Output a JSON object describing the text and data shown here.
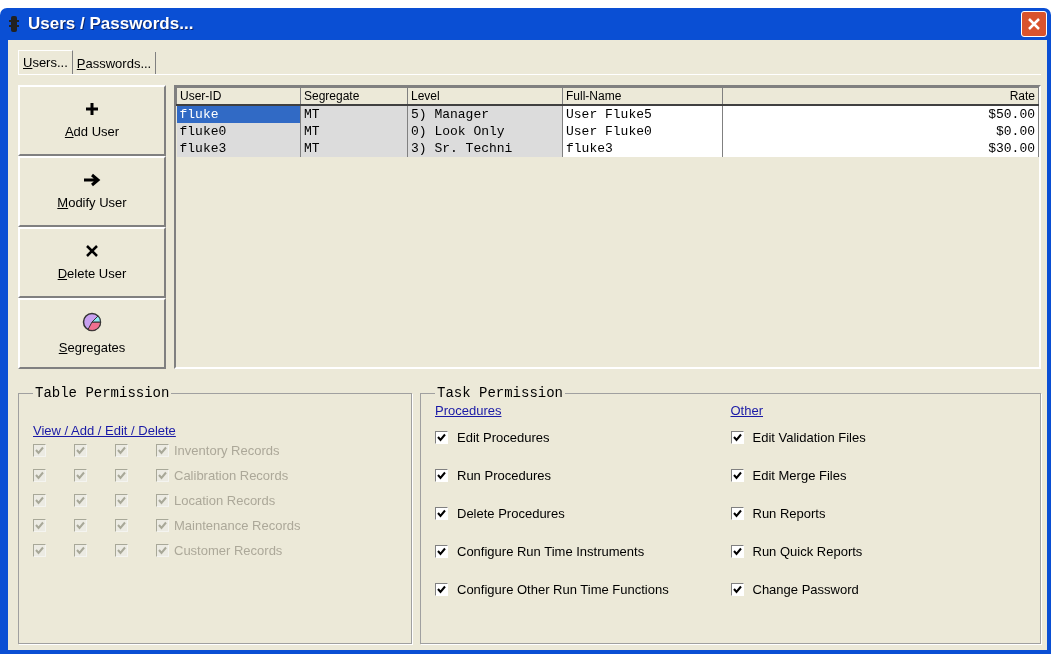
{
  "window": {
    "title": "Users / Passwords..."
  },
  "tabs": [
    {
      "label": "Users...",
      "selected": true
    },
    {
      "label": "Passwords...",
      "selected": false
    }
  ],
  "actions": [
    {
      "kind": "add",
      "label": "Add User"
    },
    {
      "kind": "modify",
      "label": "Modify User"
    },
    {
      "kind": "delete",
      "label": "Delete User"
    },
    {
      "kind": "segregates",
      "label": "Segregates"
    }
  ],
  "table": {
    "columns": [
      {
        "label": "User-ID",
        "kind": "text",
        "shaded": true
      },
      {
        "label": "Segregate",
        "kind": "text",
        "shaded": true
      },
      {
        "label": "Level",
        "kind": "text",
        "shaded": true
      },
      {
        "label": "Full-Name",
        "kind": "text",
        "shaded": false
      },
      {
        "label": "Rate",
        "kind": "money",
        "shaded": false
      }
    ],
    "rows": [
      {
        "cells": [
          "fluke",
          "MT",
          "5) Manager",
          "User Fluke5",
          "$50.00"
        ],
        "selected": true
      },
      {
        "cells": [
          "fluke0",
          "MT",
          "0) Look Only",
          "User Fluke0",
          "$0.00"
        ],
        "selected": false
      },
      {
        "cells": [
          "fluke3",
          "MT",
          "3) Sr. Techni",
          "fluke3",
          "$30.00"
        ],
        "selected": false
      }
    ]
  },
  "table_permission": {
    "title": "Table Permission",
    "header": "View / Add / Edit / Delete",
    "disabled": true,
    "rows": [
      {
        "label": "Inventory Records",
        "checks": [
          true,
          true,
          true,
          true
        ]
      },
      {
        "label": "Calibration Records",
        "checks": [
          true,
          true,
          true,
          true
        ]
      },
      {
        "label": "Location Records",
        "checks": [
          true,
          true,
          true,
          true
        ]
      },
      {
        "label": "Maintenance Records",
        "checks": [
          true,
          true,
          true,
          true
        ]
      },
      {
        "label": "Customer Records",
        "checks": [
          true,
          true,
          true,
          true
        ]
      }
    ]
  },
  "task_permission": {
    "title": "Task Permission",
    "groups": [
      {
        "header": "Procedures",
        "items": [
          {
            "label": "Edit Procedures",
            "checked": true
          },
          {
            "label": "Run Procedures",
            "checked": true
          },
          {
            "label": "Delete Procedures",
            "checked": true
          },
          {
            "label": "Configure Run Time Instruments",
            "checked": true
          },
          {
            "label": "Configure Other Run Time Functions",
            "checked": true
          }
        ]
      },
      {
        "header": "Other",
        "items": [
          {
            "label": "Edit Validation Files",
            "checked": true
          },
          {
            "label": "Edit Merge Files",
            "checked": true
          },
          {
            "label": "Run Reports",
            "checked": true
          },
          {
            "label": "Run Quick Reports",
            "checked": true
          },
          {
            "label": "Change Password",
            "checked": true
          }
        ]
      }
    ]
  }
}
